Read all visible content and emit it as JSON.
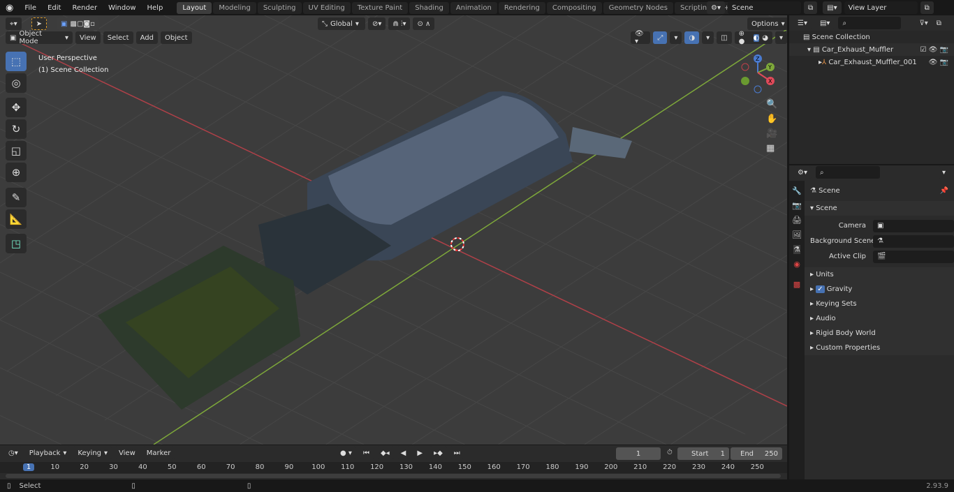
{
  "topbar": {
    "menus": [
      "File",
      "Edit",
      "Render",
      "Window",
      "Help"
    ],
    "workspaces": [
      "Layout",
      "Modeling",
      "Sculpting",
      "UV Editing",
      "Texture Paint",
      "Shading",
      "Animation",
      "Rendering",
      "Compositing",
      "Geometry Nodes",
      "Scripting"
    ],
    "active_workspace": "Layout",
    "scene": "Scene",
    "view_layer": "View Layer"
  },
  "viewport": {
    "mode": "Object Mode",
    "menus": [
      "View",
      "Select",
      "Add",
      "Object"
    ],
    "orientation": "Global",
    "options": "Options",
    "overlay_text": [
      "User Perspective",
      "(1) Scene Collection"
    ],
    "gizmo": {
      "x": "X",
      "y": "Y",
      "z": "Z"
    },
    "colors": {
      "x_axis": "#c0404a",
      "y_axis": "#7ea83a",
      "background": "#3c3c3c"
    }
  },
  "outliner": {
    "root": "Scene Collection",
    "items": [
      {
        "name": "Car_Exhaust_Muffler",
        "type": "collection"
      },
      {
        "name": "Car_Exhaust_Muffler_001",
        "type": "object"
      }
    ]
  },
  "properties": {
    "breadcrumb": "Scene",
    "section": "Scene",
    "fields": [
      {
        "label": "Camera",
        "value": ""
      },
      {
        "label": "Background Scene",
        "value": ""
      },
      {
        "label": "Active Clip",
        "value": ""
      }
    ],
    "panels": [
      "Units",
      "Gravity",
      "Keying Sets",
      "Audio",
      "Rigid Body World",
      "Custom Properties"
    ],
    "gravity_checked": true
  },
  "timeline": {
    "menus": [
      "Playback",
      "Keying",
      "View",
      "Marker"
    ],
    "current_frame": "1",
    "start_label": "Start",
    "start": "1",
    "end_label": "End",
    "end": "250",
    "ruler": [
      "1",
      "10",
      "20",
      "30",
      "40",
      "50",
      "60",
      "70",
      "80",
      "90",
      "100",
      "110",
      "120",
      "130",
      "140",
      "150",
      "160",
      "170",
      "180",
      "190",
      "200",
      "210",
      "220",
      "230",
      "240",
      "250"
    ]
  },
  "status": {
    "left": "Select",
    "version": "2.93.9"
  }
}
